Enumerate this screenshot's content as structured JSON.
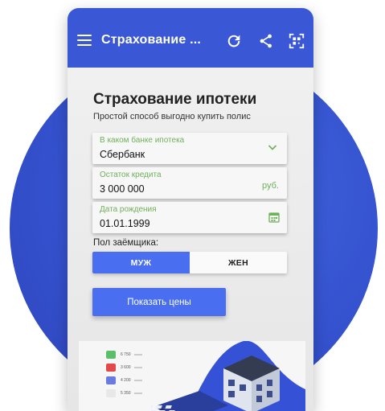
{
  "app": {
    "title": "Страхование ...",
    "colors": {
      "primary": "#3a57d6",
      "accent": "#4a6ef0",
      "label_green": "#6fb05a"
    },
    "icons": [
      "menu-icon",
      "refresh-icon",
      "share-icon",
      "qr-code-icon"
    ]
  },
  "page": {
    "heading": "Страхование ипотеки",
    "subtitle": "Простой способ выгодно купить полис"
  },
  "form": {
    "bank": {
      "label": "В каком банке ипотека",
      "value": "Сбербанк"
    },
    "balance": {
      "label": "Остаток кредита",
      "value": "3 000 000",
      "unit": "руб."
    },
    "birth": {
      "label": "Дата рождения",
      "value": "01.01.1999"
    },
    "gender": {
      "label": "Пол заёмщика:",
      "options": [
        "МУЖ",
        "ЖЕН"
      ],
      "selected": "МУЖ"
    },
    "submit_label": "Показать цены"
  },
  "promo": {
    "prices": [
      "6 750",
      "3 600",
      "4 200",
      "5 350"
    ]
  }
}
